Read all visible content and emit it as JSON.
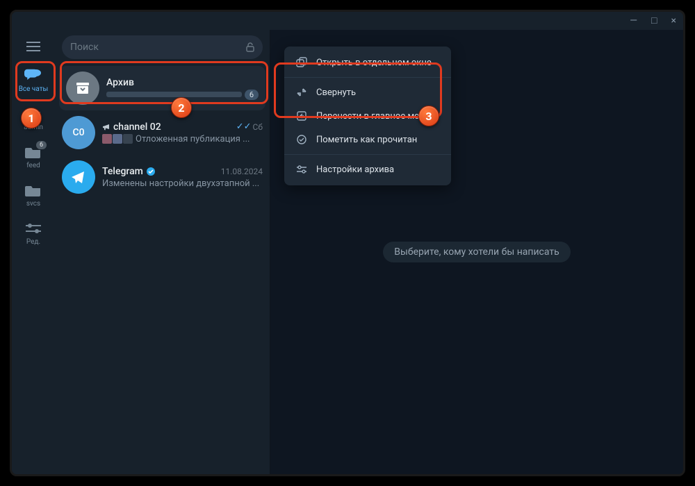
{
  "window": {
    "min": "—",
    "max": "□",
    "close": "×"
  },
  "search": {
    "placeholder": "Поиск"
  },
  "folders": {
    "all": "Все чаты",
    "admin": "admin",
    "feed": "feed",
    "feed_badge": "6",
    "svcs": "svcs",
    "edit": "Ред."
  },
  "chats": {
    "archive": {
      "name": "Архив",
      "count": "6"
    },
    "c0": {
      "avatar": "C0",
      "name": "channel 02",
      "time": "Сб",
      "sub": "Отложенная публикация ..."
    },
    "tg": {
      "name": "Telegram",
      "time": "11.08.2024",
      "sub": "Изменены настройки двухэтапной ..."
    }
  },
  "ctx": {
    "open_window": "Открыть в отдельном окне",
    "collapse": "Свернуть",
    "move_main": "Перенести в главное меню",
    "mark_read": "Пометить как прочитан",
    "settings": "Настройки архива"
  },
  "main": {
    "placeholder": "Выберите, кому хотели бы написать"
  },
  "annot": {
    "n1": "1",
    "n2": "2",
    "n3": "3"
  }
}
